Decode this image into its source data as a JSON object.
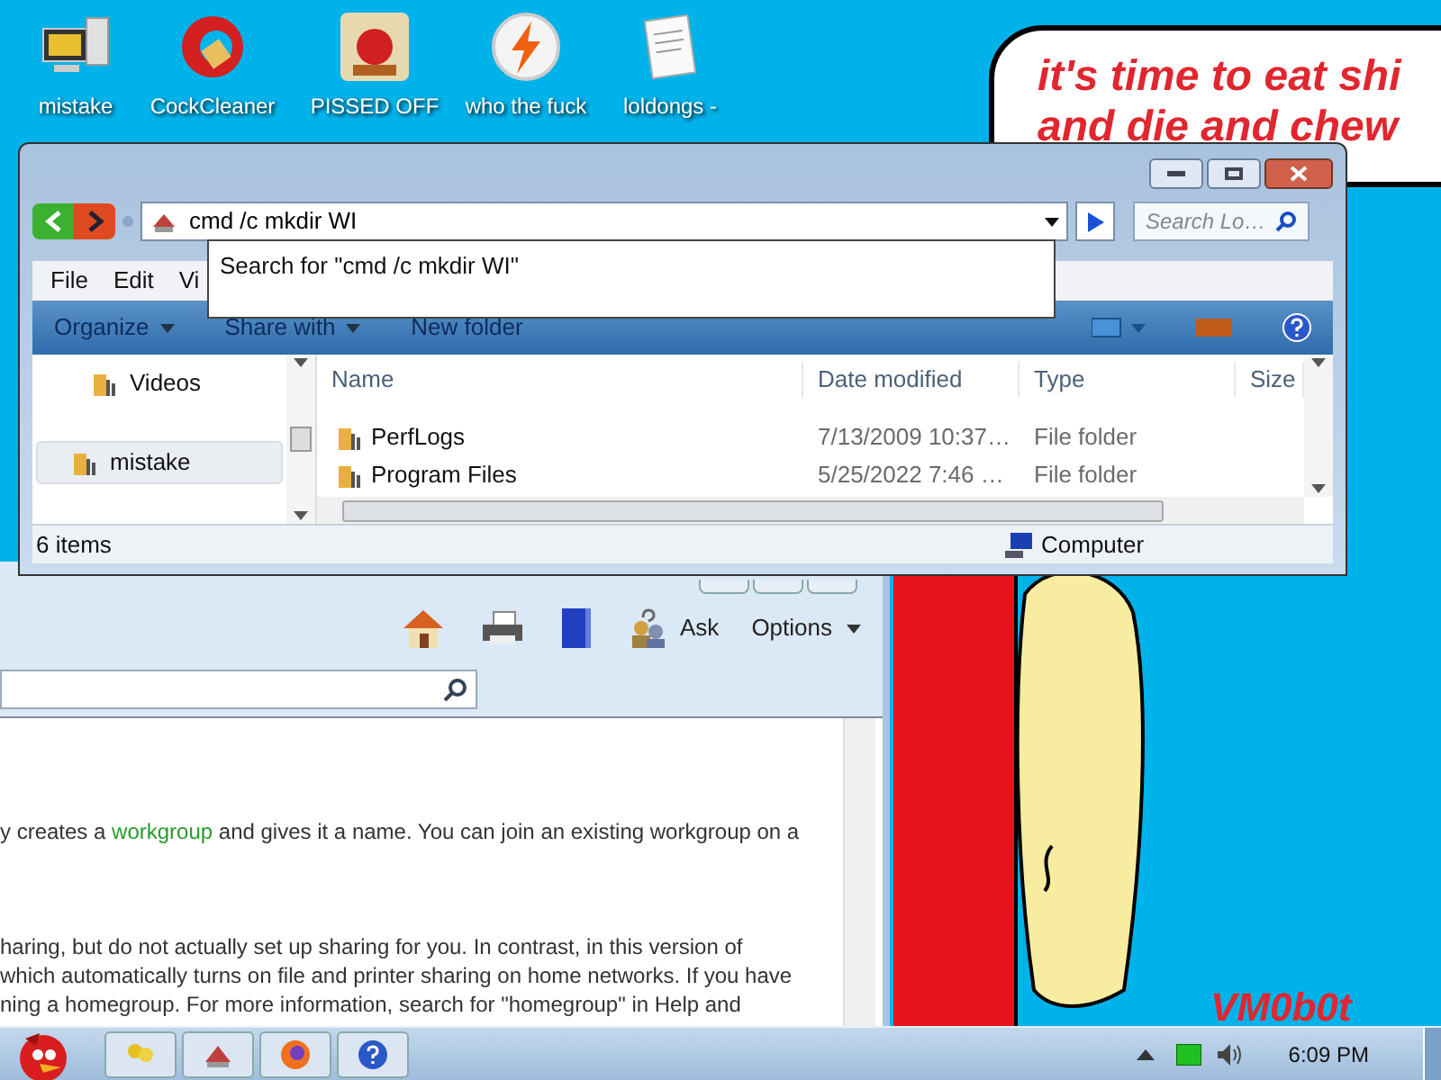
{
  "desktop_icons": [
    {
      "label": "mistake",
      "kind": "computer"
    },
    {
      "label": "CockCleaner",
      "kind": "cleaner"
    },
    {
      "label": "PISSED OFF",
      "kind": "game"
    },
    {
      "label": "who the fuck",
      "kind": "bolt"
    },
    {
      "label": "loldongs -",
      "kind": "document"
    }
  ],
  "wallpaper": {
    "speech_lines": [
      "it's time to eat shi",
      "and die and chew"
    ],
    "signature": "VM0b0t"
  },
  "help_window": {
    "ask": "Ask",
    "options": "Options",
    "paragraphs": [
      {
        "before": "y creates a ",
        "link": "workgroup",
        "after": " and gives it a name. You can join an existing workgroup on a"
      },
      {
        "lines": [
          "haring, but do not actually set up sharing for you. In contrast, in this version of",
          "which automatically turns on file and printer sharing on home networks. If you have",
          "ning a homegroup. For more information, search for \"homegroup\" in Help and"
        ]
      }
    ]
  },
  "explorer": {
    "address": "cmd /c mkdir WI",
    "search_placeholder": "Search Lo…",
    "suggestion": "Search for \"cmd /c mkdir WI\"",
    "menu": [
      "File",
      "Edit",
      "Vi"
    ],
    "toolbar": [
      {
        "label": "Organize",
        "dropdown": true
      },
      {
        "label": "Share with",
        "dropdown": true
      },
      {
        "label": "New folder",
        "dropdown": false
      }
    ],
    "nav_items": [
      {
        "label": "Videos",
        "selected": false
      },
      {
        "label": "mistake",
        "selected": true
      }
    ],
    "columns": [
      "Name",
      "Date modified",
      "Type",
      "Size"
    ],
    "rows": [
      {
        "name": "PerfLogs",
        "date": "7/13/2009 10:37…",
        "type": "File folder"
      },
      {
        "name": "Program Files",
        "date": "5/25/2022 7:46 …",
        "type": "File folder"
      }
    ],
    "status": {
      "count": "6 items",
      "location": "Computer"
    }
  },
  "taskbar": {
    "clock": "6:09 PM"
  }
}
